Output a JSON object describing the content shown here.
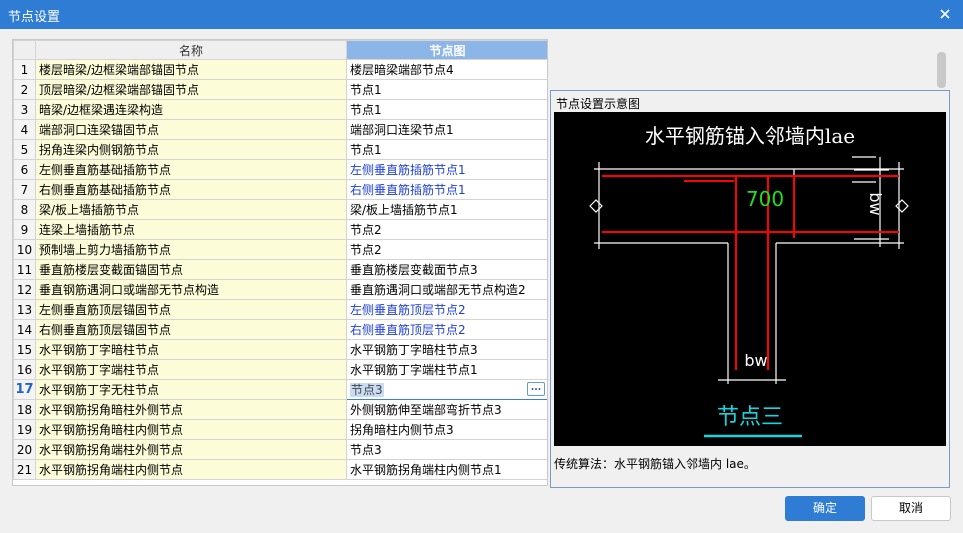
{
  "window": {
    "title": "节点设置"
  },
  "grid": {
    "headers": {
      "name": "名称",
      "node": "节点图"
    },
    "rows": [
      {
        "num": "1",
        "name": "楼层暗梁/边框梁端部锚固节点",
        "node": "楼层暗梁端部节点4",
        "highlight": false
      },
      {
        "num": "2",
        "name": "顶层暗梁/边框梁端部锚固节点",
        "node": "节点1",
        "highlight": false
      },
      {
        "num": "3",
        "name": "暗梁/边框梁遇连梁构造",
        "node": "节点1",
        "highlight": false
      },
      {
        "num": "4",
        "name": "端部洞口连梁锚固节点",
        "node": "端部洞口连梁节点1",
        "highlight": false
      },
      {
        "num": "5",
        "name": "拐角连梁内侧钢筋节点",
        "node": "节点1",
        "highlight": false
      },
      {
        "num": "6",
        "name": "左侧垂直筋基础插筋节点",
        "node": "左侧垂直筋插筋节点1",
        "highlight": true
      },
      {
        "num": "7",
        "name": "右侧垂直筋基础插筋节点",
        "node": "右侧垂直筋插筋节点1",
        "highlight": true
      },
      {
        "num": "8",
        "name": "梁/板上墙插筋节点",
        "node": "梁/板上墙插筋节点1",
        "highlight": false
      },
      {
        "num": "9",
        "name": "连梁上墙插筋节点",
        "node": "节点2",
        "highlight": false
      },
      {
        "num": "10",
        "name": "预制墙上剪力墙插筋节点",
        "node": "节点2",
        "highlight": false
      },
      {
        "num": "11",
        "name": "垂直筋楼层变截面锚固节点",
        "node": "垂直筋楼层变截面节点3",
        "highlight": false
      },
      {
        "num": "12",
        "name": "垂直钢筋遇洞口或端部无节点构造",
        "node": "垂直筋遇洞口或端部无节点构造2",
        "highlight": false
      },
      {
        "num": "13",
        "name": "左侧垂直筋顶层锚固节点",
        "node": "左侧垂直筋顶层节点2",
        "highlight": true
      },
      {
        "num": "14",
        "name": "右侧垂直筋顶层锚固节点",
        "node": "右侧垂直筋顶层节点2",
        "highlight": true
      },
      {
        "num": "15",
        "name": "水平钢筋丁字暗柱节点",
        "node": "水平钢筋丁字暗柱节点3",
        "highlight": false
      },
      {
        "num": "16",
        "name": "水平钢筋丁字端柱节点",
        "node": "水平钢筋丁字端柱节点1",
        "highlight": false
      },
      {
        "num": "17",
        "name": "水平钢筋丁字无柱节点",
        "node": "节点3",
        "highlight": false,
        "selected": true
      },
      {
        "num": "18",
        "name": "水平钢筋拐角暗柱外侧节点",
        "node": "外侧钢筋伸至端部弯折节点3",
        "highlight": false
      },
      {
        "num": "19",
        "name": "水平钢筋拐角暗柱内侧节点",
        "node": "拐角暗柱内侧节点3",
        "highlight": false
      },
      {
        "num": "20",
        "name": "水平钢筋拐角端柱外侧节点",
        "node": "节点3",
        "highlight": false
      },
      {
        "num": "21",
        "name": "水平钢筋拐角端柱内侧节点",
        "node": "水平钢筋拐角端柱内侧节点1",
        "highlight": false
      }
    ]
  },
  "preview": {
    "caption": "节点设置示意图",
    "diagram_title": "水平钢筋锚入邻墙内lae",
    "dim_value": "700",
    "dim_bw_right": "bw",
    "dim_bw_bottom": "bw",
    "node_name": "节点三",
    "description": "传统算法：水平钢筋锚入邻墙内 lae。"
  },
  "buttons": {
    "ok": "确定",
    "cancel": "取消"
  },
  "colors": {
    "titlebar": "#2f7cd4",
    "accent": "#2f7cd4",
    "rebar": "#ff0000",
    "dim_text": "#22dd22",
    "node_label": "#19d3de"
  }
}
